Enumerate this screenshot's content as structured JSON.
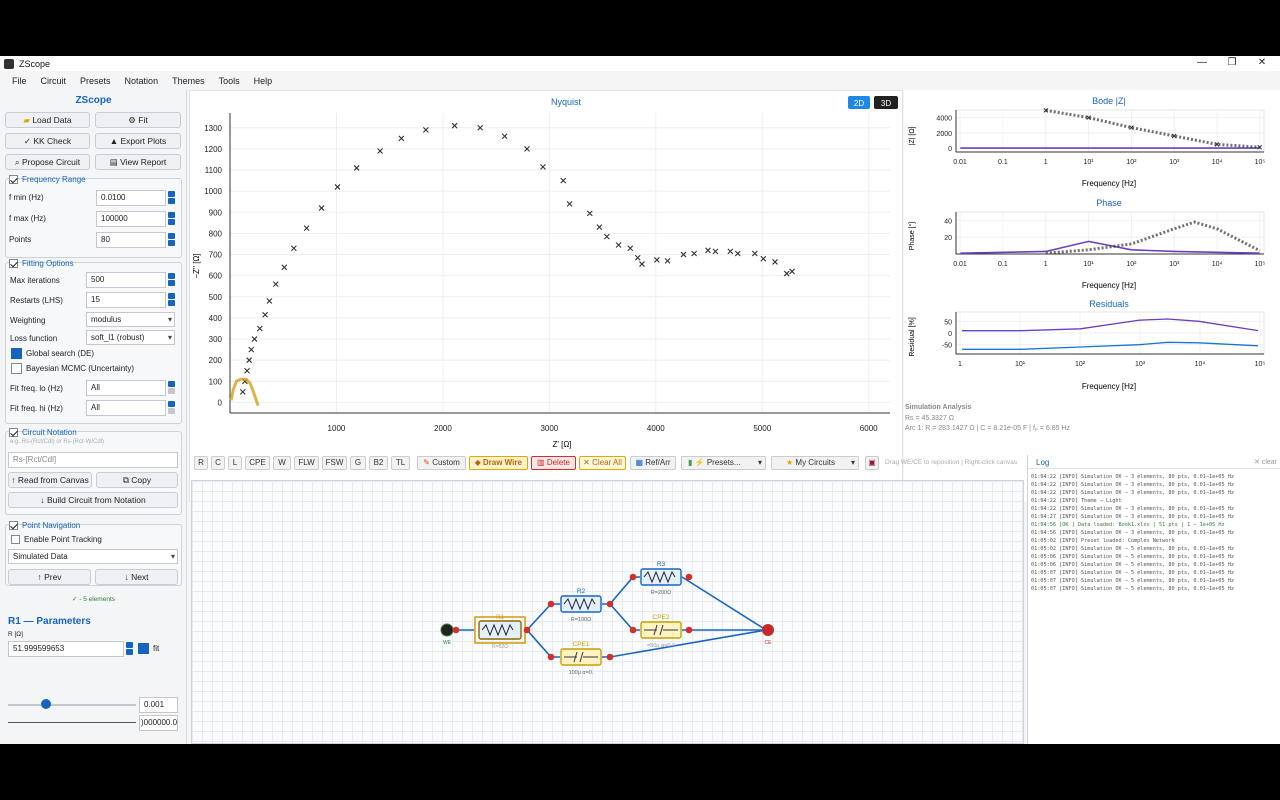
{
  "window": {
    "title": "ZScope",
    "controls": [
      "—",
      "❐",
      "✕"
    ]
  },
  "menu": [
    "File",
    "Circuit",
    "Presets",
    "Notation",
    "Themes",
    "Tools",
    "Help"
  ],
  "sidebar": {
    "app_title": "ZScope",
    "buttons": {
      "load": "Load Data",
      "fit": "Fit",
      "kk": "KK Check",
      "export": "Export Plots",
      "propose": "Propose Circuit",
      "report": "View Report"
    },
    "frequency": {
      "title": "Frequency Range",
      "fmin_label": "f min (Hz)",
      "fmin": "0.0100",
      "fmax_label": "f max (Hz)",
      "fmax": "100000",
      "points_label": "Points",
      "points": "80"
    },
    "fitting": {
      "title": "Fitting Options",
      "maxit_label": "Max iterations",
      "maxit": "500",
      "restarts_label": "Restarts (LHS)",
      "restarts": "15",
      "weighting_label": "Weighting",
      "weighting": "modulus",
      "loss_label": "Loss function",
      "loss": "soft_l1 (robust)",
      "global": "Global search (DE)",
      "bayes": "Bayesian MCMC (Uncertainty)",
      "lo_label": "Fit freq. lo (Hz)",
      "lo": "All",
      "hi_label": "Fit freq. hi (Hz)",
      "hi": "All"
    },
    "notation": {
      "title": "Circuit Notation",
      "hint": "e.g. Rs-(Rct/Cdl) or Rs-(Rct-W/Cdl)",
      "placeholder": "Rs-[Rct/Cdl]",
      "read": "↑ Read from Canvas",
      "copy": "Copy",
      "build": "↓ Build Circuit from Notation"
    },
    "points": {
      "title": "Point Navigation",
      "tracking": "Enable Point Tracking",
      "source": "Simulated Data",
      "prev": "↑ Prev",
      "next": "↓ Next"
    },
    "status": "✓ - 5 elements",
    "params": {
      "title": "R1  —  Parameters",
      "unit": "R  [Ω]",
      "value": "51.999599653",
      "fit": "fit",
      "min": "0.001",
      "max": ")000000.0",
      "slider_fraction": 0.3
    }
  },
  "nyquist": {
    "title": "Nyquist",
    "mode_2d": "2D",
    "mode_3d": "3D",
    "chart_data": {
      "type": "scatter",
      "xlabel": "Z' [Ω]",
      "ylabel": "−Z'' [Ω]",
      "xlim": [
        0,
        6200
      ],
      "ylim": [
        -50,
        1370
      ],
      "xticks": [
        1000,
        2000,
        3000,
        4000,
        5000,
        6000
      ],
      "yticks": [
        0,
        100,
        200,
        300,
        400,
        500,
        600,
        700,
        800,
        900,
        1000,
        1100,
        1200,
        1300
      ],
      "series": [
        {
          "values": [
            [
              120,
              50
            ],
            [
              140,
              100
            ],
            [
              160,
              150
            ],
            [
              180,
              200
            ],
            [
              200,
              250
            ],
            [
              230,
              300
            ],
            [
              280,
              350
            ],
            [
              330,
              415
            ],
            [
              370,
              480
            ],
            [
              430,
              560
            ],
            [
              510,
              640
            ],
            [
              600,
              730
            ],
            [
              720,
              825
            ],
            [
              860,
              920
            ],
            [
              1010,
              1020
            ],
            [
              1190,
              1110
            ],
            [
              1410,
              1190
            ],
            [
              1610,
              1250
            ],
            [
              1840,
              1290
            ],
            [
              2110,
              1310
            ],
            [
              2350,
              1300
            ],
            [
              2580,
              1260
            ],
            [
              2790,
              1200
            ],
            [
              2940,
              1115
            ],
            [
              3130,
              1050
            ],
            [
              3190,
              940
            ],
            [
              3380,
              895
            ],
            [
              3470,
              830
            ],
            [
              3540,
              785
            ],
            [
              3650,
              745
            ],
            [
              3760,
              730
            ],
            [
              3830,
              685
            ],
            [
              3870,
              655
            ],
            [
              4010,
              675
            ],
            [
              4110,
              670
            ],
            [
              4260,
              700
            ],
            [
              4360,
              705
            ],
            [
              4490,
              720
            ],
            [
              4560,
              715
            ],
            [
              4700,
              715
            ],
            [
              4770,
              705
            ],
            [
              4930,
              705
            ],
            [
              5010,
              680
            ],
            [
              5120,
              665
            ],
            [
              5230,
              610
            ],
            [
              5280,
              620
            ]
          ]
        },
        {
          "values": [
            [
              10,
              10
            ],
            [
              30,
              60
            ],
            [
              60,
              100
            ],
            [
              100,
              110
            ],
            [
              150,
              110
            ],
            [
              190,
              90
            ],
            [
              220,
              50
            ],
            [
              250,
              5
            ],
            [
              265,
              -15
            ]
          ]
        }
      ]
    }
  },
  "bode_mag": {
    "title": "Bode |Z|",
    "chart_data": {
      "type": "line",
      "xlabel": "Frequency [Hz]",
      "ylabel": "|Z| [Ω]",
      "xscale": "log",
      "xticks": [
        "0.01",
        "0.1",
        "1",
        "10¹",
        "10²",
        "10³",
        "10⁴",
        "10⁵"
      ],
      "yticks": [
        "4000",
        "2000",
        "0"
      ],
      "ylim": [
        -500,
        5000
      ],
      "series": [
        {
          "values": [
            [
              0.01,
              20
            ],
            [
              100000,
              15
            ]
          ]
        },
        {
          "values": [
            [
              1,
              4950
            ],
            [
              10,
              4000
            ],
            [
              100,
              2700
            ],
            [
              1000,
              1600
            ],
            [
              10000,
              500
            ],
            [
              100000,
              130
            ]
          ]
        }
      ]
    }
  },
  "phase": {
    "title": "Phase",
    "chart_data": {
      "type": "line",
      "xlabel": "Frequency [Hz]",
      "ylabel": "Phase [°]",
      "xscale": "log",
      "xticks": [
        "0.01",
        "0.1",
        "1",
        "10¹",
        "10²",
        "10³",
        "10⁴",
        "10⁵"
      ],
      "yticks": [
        "20",
        "40"
      ],
      "ylim": [
        0,
        50
      ],
      "series": [
        {
          "values": [
            [
              0.01,
              1
            ],
            [
              1,
              3
            ],
            [
              10,
              15
            ],
            [
              100,
              5
            ],
            [
              1000,
              3
            ],
            [
              10000,
              2
            ],
            [
              100000,
              1
            ]
          ]
        },
        {
          "values": [
            [
              1,
              1
            ],
            [
              10,
              5
            ],
            [
              100,
              12
            ],
            [
              1000,
              30
            ],
            [
              3000,
              38
            ],
            [
              10000,
              30
            ],
            [
              100000,
              4
            ]
          ]
        }
      ]
    }
  },
  "residuals": {
    "title": "Residuals",
    "chart_data": {
      "type": "line",
      "xlabel": "Frequency [Hz]",
      "ylabel": "Residual [%]",
      "xscale": "log",
      "xticks": [
        "1",
        "10¹",
        "10²",
        "10³",
        "10⁴",
        "10⁵"
      ],
      "yticks": [
        "50",
        "0",
        "-50"
      ],
      "ylim": [
        -90,
        90
      ],
      "series": [
        {
          "values": [
            [
              1,
              10
            ],
            [
              10,
              10
            ],
            [
              100,
              18
            ],
            [
              1000,
              55
            ],
            [
              3000,
              60
            ],
            [
              10000,
              50
            ],
            [
              100000,
              10
            ]
          ]
        },
        {
          "values": [
            [
              1,
              -70
            ],
            [
              10,
              -70
            ],
            [
              100,
              -60
            ],
            [
              1000,
              -50
            ],
            [
              3000,
              -40
            ],
            [
              10000,
              -42
            ],
            [
              100000,
              -55
            ]
          ]
        }
      ]
    }
  },
  "analysis": {
    "title": "Simulation Analysis",
    "rs": "Rs = 45.3327 Ω",
    "arc": "Arc 1: R = 283.1427 Ω | C = 8.21e-05 F | fₚ = 6.85 Hz"
  },
  "toolbar": {
    "elements": [
      "R",
      "C",
      "L",
      "CPE",
      "W",
      "FLW",
      "FSW",
      "G",
      "B2",
      "TL"
    ],
    "custom": "Custom",
    "draw": "Draw Wire",
    "delete": "Delete",
    "clear": "Clear All",
    "ref": "Ref/Arr",
    "presets": "Presets...",
    "my": "My Circuits",
    "hint": "Drag WE/CE to reposition | Right-click canvas"
  },
  "circuit": {
    "we": "WE",
    "ce": "CE",
    "r1": "R1",
    "r1v": "R=52Ω",
    "r2": "R2",
    "r2v": "R=100Ω",
    "r3": "R3",
    "r3v": "R=200Ω",
    "cpe1": "CPE1",
    "cpe1v": "100μ  α=0.",
    "cpe2": "CPE2",
    "cpe2v": "=50μ  α=0.4"
  },
  "log": {
    "title": "Log",
    "clear": "✕ clear",
    "lines": [
      {
        "t": "01:04:22 [INFO] Simulation OK – 3 elements, 80 pts, 0.01–1e+05 Hz"
      },
      {
        "t": "01:04:22 [INFO] Simulation OK – 3 elements, 80 pts, 0.01–1e+05 Hz"
      },
      {
        "t": "01:04:22 [INFO] Simulation OK – 3 elements, 80 pts, 0.01–1e+05 Hz"
      },
      {
        "t": "01:04:22 [INFO] Theme → Light"
      },
      {
        "t": "01:04:22 [INFO] Simulation OK – 3 elements, 80 pts, 0.01–1e+05 Hz"
      },
      {
        "t": "01:04:27 [INFO] Simulation OK – 3 elements, 80 pts, 0.01–1e+05 Hz"
      },
      {
        "t": "01:04:56 [OK  ] Data loaded: Book1.xlsx  |  51 pts  |  1 – 1e+05 Hz",
        "ok": true
      },
      {
        "t": "01:04:56 [INFO] Simulation OK – 3 elements, 80 pts, 0.01–1e+05 Hz"
      },
      {
        "t": "01:05:02 [INFO] Preset loaded: Complex Network"
      },
      {
        "t": "01:05:02 [INFO] Simulation OK – 5 elements, 80 pts, 0.01–1e+05 Hz"
      },
      {
        "t": "01:05:06 [INFO] Simulation OK – 5 elements, 80 pts, 0.01–1e+05 Hz"
      },
      {
        "t": "01:05:06 [INFO] Simulation OK – 5 elements, 80 pts, 0.01–1e+05 Hz"
      },
      {
        "t": "01:05:07 [INFO] Simulation OK – 5 elements, 80 pts, 0.01–1e+05 Hz"
      },
      {
        "t": "01:05:07 [INFO] Simulation OK – 5 elements, 80 pts, 0.01–1e+05 Hz"
      },
      {
        "t": "01:05:07 [INFO] Simulation OK – 5 elements, 80 pts, 0.01–1e+05 Hz"
      }
    ]
  },
  "colors": {
    "accent": "#1565c0",
    "series_sim": "#6a3fc0",
    "series_data": "#333333",
    "series_resid2": "#1976d2",
    "overlay": "#d4a017",
    "node": "#d32f2f",
    "resistor": "#e3f0fc",
    "cpe": "#fff3c4"
  }
}
